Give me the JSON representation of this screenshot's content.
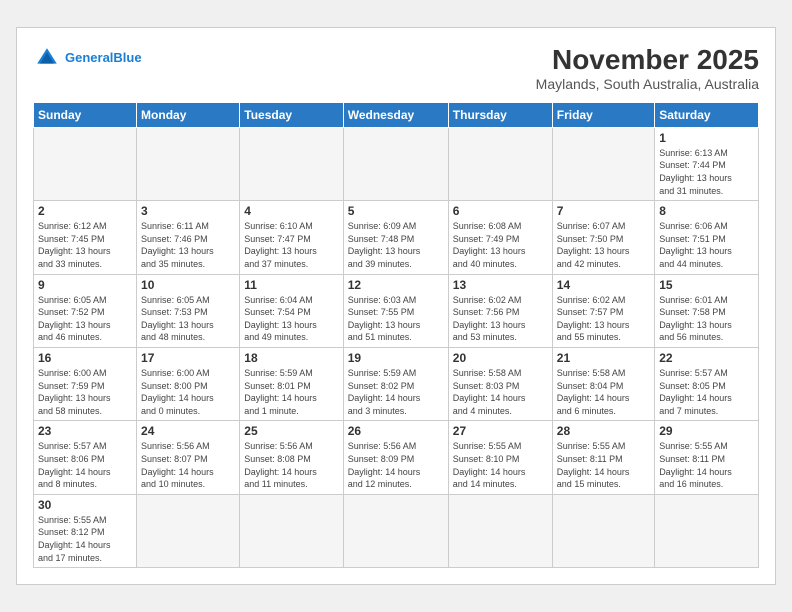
{
  "header": {
    "logo_general": "General",
    "logo_blue": "Blue",
    "month_title": "November 2025",
    "location": "Maylands, South Australia, Australia"
  },
  "weekdays": [
    "Sunday",
    "Monday",
    "Tuesday",
    "Wednesday",
    "Thursday",
    "Friday",
    "Saturday"
  ],
  "weeks": [
    [
      {
        "day": "",
        "info": ""
      },
      {
        "day": "",
        "info": ""
      },
      {
        "day": "",
        "info": ""
      },
      {
        "day": "",
        "info": ""
      },
      {
        "day": "",
        "info": ""
      },
      {
        "day": "",
        "info": ""
      },
      {
        "day": "1",
        "info": "Sunrise: 6:13 AM\nSunset: 7:44 PM\nDaylight: 13 hours\nand 31 minutes."
      }
    ],
    [
      {
        "day": "2",
        "info": "Sunrise: 6:12 AM\nSunset: 7:45 PM\nDaylight: 13 hours\nand 33 minutes."
      },
      {
        "day": "3",
        "info": "Sunrise: 6:11 AM\nSunset: 7:46 PM\nDaylight: 13 hours\nand 35 minutes."
      },
      {
        "day": "4",
        "info": "Sunrise: 6:10 AM\nSunset: 7:47 PM\nDaylight: 13 hours\nand 37 minutes."
      },
      {
        "day": "5",
        "info": "Sunrise: 6:09 AM\nSunset: 7:48 PM\nDaylight: 13 hours\nand 39 minutes."
      },
      {
        "day": "6",
        "info": "Sunrise: 6:08 AM\nSunset: 7:49 PM\nDaylight: 13 hours\nand 40 minutes."
      },
      {
        "day": "7",
        "info": "Sunrise: 6:07 AM\nSunset: 7:50 PM\nDaylight: 13 hours\nand 42 minutes."
      },
      {
        "day": "8",
        "info": "Sunrise: 6:06 AM\nSunset: 7:51 PM\nDaylight: 13 hours\nand 44 minutes."
      }
    ],
    [
      {
        "day": "9",
        "info": "Sunrise: 6:05 AM\nSunset: 7:52 PM\nDaylight: 13 hours\nand 46 minutes."
      },
      {
        "day": "10",
        "info": "Sunrise: 6:05 AM\nSunset: 7:53 PM\nDaylight: 13 hours\nand 48 minutes."
      },
      {
        "day": "11",
        "info": "Sunrise: 6:04 AM\nSunset: 7:54 PM\nDaylight: 13 hours\nand 49 minutes."
      },
      {
        "day": "12",
        "info": "Sunrise: 6:03 AM\nSunset: 7:55 PM\nDaylight: 13 hours\nand 51 minutes."
      },
      {
        "day": "13",
        "info": "Sunrise: 6:02 AM\nSunset: 7:56 PM\nDaylight: 13 hours\nand 53 minutes."
      },
      {
        "day": "14",
        "info": "Sunrise: 6:02 AM\nSunset: 7:57 PM\nDaylight: 13 hours\nand 55 minutes."
      },
      {
        "day": "15",
        "info": "Sunrise: 6:01 AM\nSunset: 7:58 PM\nDaylight: 13 hours\nand 56 minutes."
      }
    ],
    [
      {
        "day": "16",
        "info": "Sunrise: 6:00 AM\nSunset: 7:59 PM\nDaylight: 13 hours\nand 58 minutes."
      },
      {
        "day": "17",
        "info": "Sunrise: 6:00 AM\nSunset: 8:00 PM\nDaylight: 14 hours\nand 0 minutes."
      },
      {
        "day": "18",
        "info": "Sunrise: 5:59 AM\nSunset: 8:01 PM\nDaylight: 14 hours\nand 1 minute."
      },
      {
        "day": "19",
        "info": "Sunrise: 5:59 AM\nSunset: 8:02 PM\nDaylight: 14 hours\nand 3 minutes."
      },
      {
        "day": "20",
        "info": "Sunrise: 5:58 AM\nSunset: 8:03 PM\nDaylight: 14 hours\nand 4 minutes."
      },
      {
        "day": "21",
        "info": "Sunrise: 5:58 AM\nSunset: 8:04 PM\nDaylight: 14 hours\nand 6 minutes."
      },
      {
        "day": "22",
        "info": "Sunrise: 5:57 AM\nSunset: 8:05 PM\nDaylight: 14 hours\nand 7 minutes."
      }
    ],
    [
      {
        "day": "23",
        "info": "Sunrise: 5:57 AM\nSunset: 8:06 PM\nDaylight: 14 hours\nand 8 minutes."
      },
      {
        "day": "24",
        "info": "Sunrise: 5:56 AM\nSunset: 8:07 PM\nDaylight: 14 hours\nand 10 minutes."
      },
      {
        "day": "25",
        "info": "Sunrise: 5:56 AM\nSunset: 8:08 PM\nDaylight: 14 hours\nand 11 minutes."
      },
      {
        "day": "26",
        "info": "Sunrise: 5:56 AM\nSunset: 8:09 PM\nDaylight: 14 hours\nand 12 minutes."
      },
      {
        "day": "27",
        "info": "Sunrise: 5:55 AM\nSunset: 8:10 PM\nDaylight: 14 hours\nand 14 minutes."
      },
      {
        "day": "28",
        "info": "Sunrise: 5:55 AM\nSunset: 8:11 PM\nDaylight: 14 hours\nand 15 minutes."
      },
      {
        "day": "29",
        "info": "Sunrise: 5:55 AM\nSunset: 8:11 PM\nDaylight: 14 hours\nand 16 minutes."
      }
    ],
    [
      {
        "day": "30",
        "info": "Sunrise: 5:55 AM\nSunset: 8:12 PM\nDaylight: 14 hours\nand 17 minutes."
      },
      {
        "day": "",
        "info": ""
      },
      {
        "day": "",
        "info": ""
      },
      {
        "day": "",
        "info": ""
      },
      {
        "day": "",
        "info": ""
      },
      {
        "day": "",
        "info": ""
      },
      {
        "day": "",
        "info": ""
      }
    ]
  ]
}
